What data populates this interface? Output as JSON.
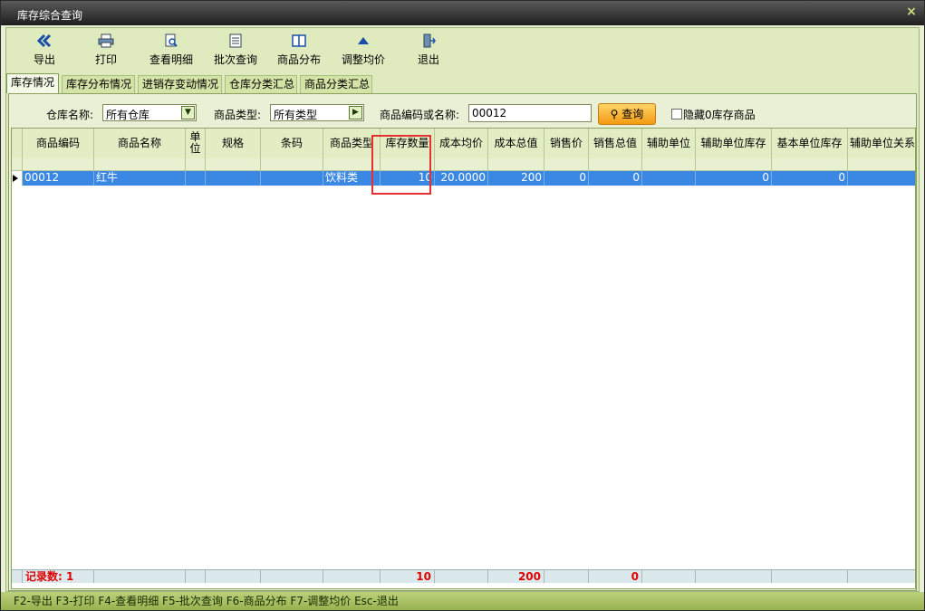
{
  "window": {
    "title": "库存综合查询",
    "close": "×"
  },
  "toolbar": [
    {
      "label": "导出",
      "icon": "double-chevron-left-icon"
    },
    {
      "label": "打印",
      "icon": "printer-icon"
    },
    {
      "label": "查看明细",
      "icon": "document-search-icon"
    },
    {
      "label": "批次查询",
      "icon": "list-icon"
    },
    {
      "label": "商品分布",
      "icon": "columns-icon"
    },
    {
      "label": "调整均价",
      "icon": "triangle-up-icon"
    },
    {
      "label": "退出",
      "icon": "exit-door-icon"
    }
  ],
  "tabs": [
    "库存情况",
    "库存分布情况",
    "进销存变动情况",
    "仓库分类汇总",
    "商品分类汇总"
  ],
  "filter": {
    "warehouse_label": "仓库名称:",
    "warehouse_value": "所有仓库",
    "category_label": "商品类型:",
    "category_value": "所有类型",
    "code_label": "商品编码或名称:",
    "code_value": "00012",
    "query_button": "查询",
    "hide_zero_label": "隐藏0库存商品"
  },
  "table": {
    "columns": [
      "商品编码",
      "商品名称",
      "单位",
      "规格",
      "条码",
      "商品类型",
      "库存数量",
      "成本均价",
      "成本总值",
      "销售价",
      "销售总值",
      "辅助单位",
      "辅助单位库存",
      "基本单位库存",
      "辅助单位关系"
    ],
    "rows": [
      [
        "00012",
        "红牛",
        "",
        "",
        "",
        "饮料类",
        "10",
        "20.0000",
        "200",
        "0",
        "0",
        "",
        "0",
        "0",
        ""
      ]
    ],
    "footer": {
      "record_count": "记录数: 1",
      "qty_total": "10",
      "cost_total": "200",
      "sales_total": "0"
    }
  },
  "statusbar": "F2-导出 F3-打印 F4-查看明细 F5-批次查询 F6-商品分布 F7-调整均价 Esc-退出",
  "colors": {
    "selected_row": "#3a88e4",
    "highlight_box": "#e53030",
    "footer_text": "#e00000"
  }
}
